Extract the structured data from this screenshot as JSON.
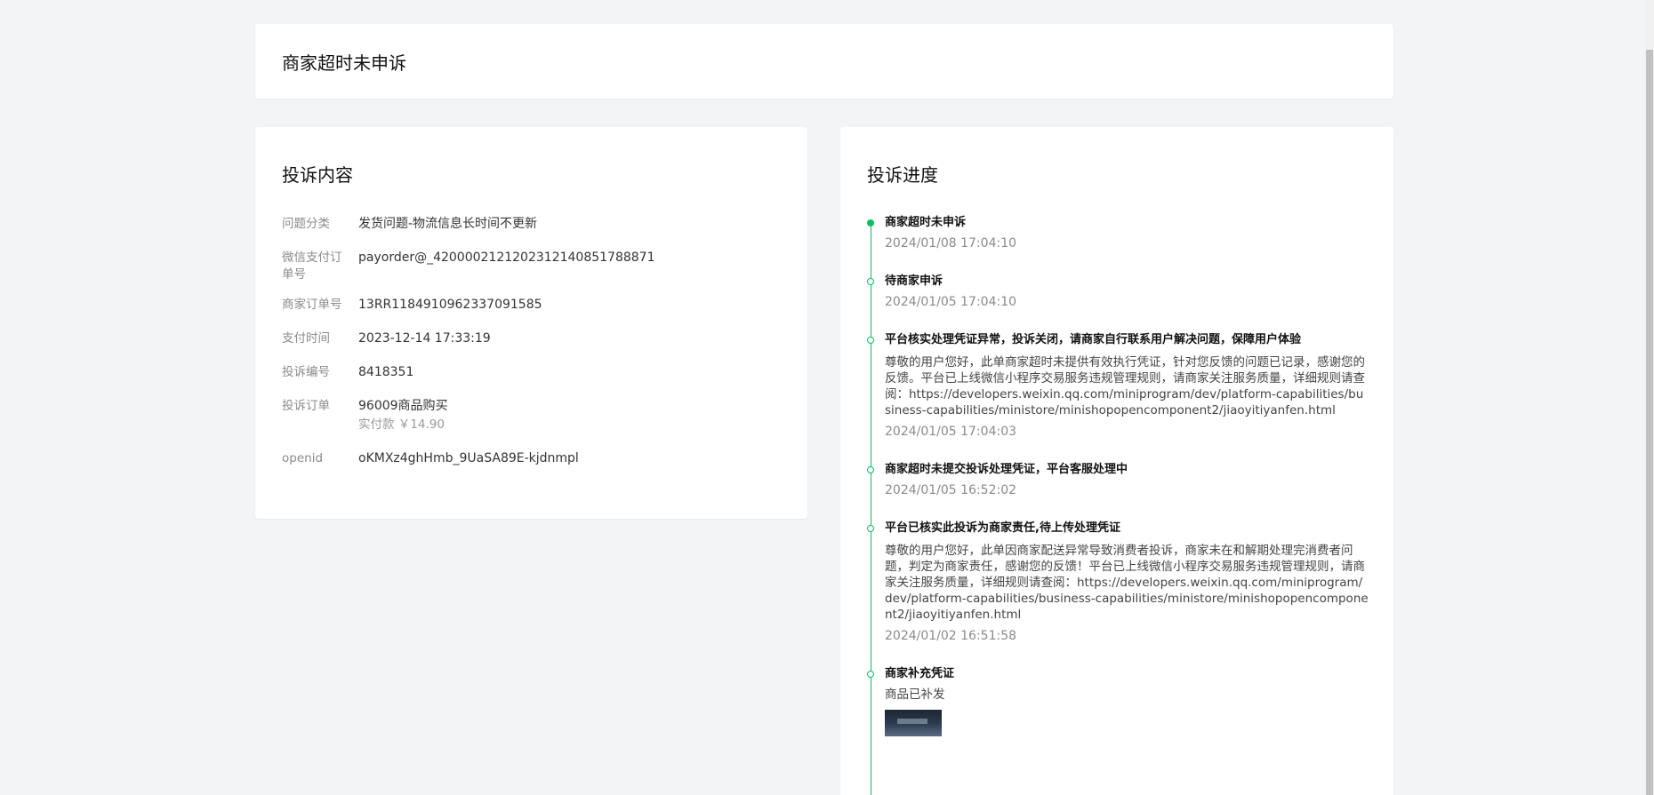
{
  "header": {
    "title": "商家超时未申诉"
  },
  "complaint": {
    "title": "投诉内容",
    "fields": [
      {
        "label": "问题分类",
        "value": "发货问题-物流信息长时间不更新"
      },
      {
        "label": "微信支付订单号",
        "value": "payorder@_4200002121202312140851788871"
      },
      {
        "label": "商家订单号",
        "value": "13RR1184910962337091585"
      },
      {
        "label": "支付时间",
        "value": "2023-12-14 17:33:19"
      },
      {
        "label": "投诉编号",
        "value": "8418351"
      },
      {
        "label": "投诉订单",
        "value": "96009商品购买",
        "sub": "实付款 ￥14.90"
      },
      {
        "label": "openid",
        "value": "oKMXz4ghHmb_9UaSA89E-kjdnmpl"
      }
    ]
  },
  "progress": {
    "title": "投诉进度",
    "items": [
      {
        "title": "商家超时未申诉",
        "time": "2024/01/08 17:04:10"
      },
      {
        "title": "待商家申诉",
        "time": "2024/01/05 17:04:10"
      },
      {
        "title": "平台核实处理凭证异常，投诉关闭，请商家自行联系用户解决问题，保障用户体验",
        "desc": "尊敬的用户您好，此单商家超时未提供有效执行凭证，针对您反馈的问题已记录，感谢您的反馈。平台已上线微信小程序交易服务违规管理规则，请商家关注服务质量，详细规则请查阅：https://developers.weixin.qq.com/miniprogram/dev/platform-capabilities/business-capabilities/ministore/minishopopencomponent2/jiaoyitiyanfen.html",
        "time": "2024/01/05 17:04:03"
      },
      {
        "title": "商家超时未提交投诉处理凭证，平台客服处理中",
        "time": "2024/01/05 16:52:02"
      },
      {
        "title": "平台已核实此投诉为商家责任,待上传处理凭证",
        "desc": "尊敬的用户您好，此单因商家配送异常导致消费者投诉，商家未在和解期处理完消费者问题，判定为商家责任，感谢您的反馈！平台已上线微信小程序交易服务违规管理规则，请商家关注服务质量，详细规则请查阅：https://developers.weixin.qq.com/miniprogram/dev/platform-capabilities/business-capabilities/ministore/minishopopencomponent2/jiaoyitiyanfen.html",
        "time": "2024/01/02 16:51:58"
      },
      {
        "title": "商家补充凭证",
        "desc": "商品已补发"
      }
    ]
  },
  "colors": {
    "accent": "#07c160",
    "background": "#f3f4f6"
  }
}
